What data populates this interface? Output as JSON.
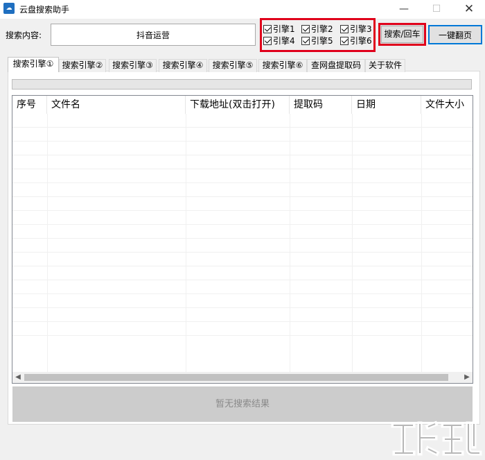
{
  "window": {
    "title": "云盘搜索助手",
    "icon": "cloud-app-icon",
    "controls": {
      "minimize": "—",
      "maximize": "☐",
      "close": "✕"
    }
  },
  "search": {
    "label": "搜索内容:",
    "value": "抖音运营"
  },
  "engines": [
    {
      "label": "引擎1",
      "checked": true
    },
    {
      "label": "引擎2",
      "checked": true
    },
    {
      "label": "引擎3",
      "checked": true
    },
    {
      "label": "引擎4",
      "checked": true
    },
    {
      "label": "引擎5",
      "checked": true
    },
    {
      "label": "引擎6",
      "checked": true
    }
  ],
  "buttons": {
    "search": "搜索/回车",
    "next_page": "一键翻页"
  },
  "tabs": [
    {
      "label": "搜索引擎①",
      "active": true
    },
    {
      "label": "搜索引擎②",
      "active": false
    },
    {
      "label": "搜索引擎③",
      "active": false
    },
    {
      "label": "搜索引擎④",
      "active": false
    },
    {
      "label": "搜索引擎⑤",
      "active": false
    },
    {
      "label": "搜索引擎⑥",
      "active": false
    },
    {
      "label": "查网盘提取码",
      "active": false
    },
    {
      "label": "关于软件",
      "active": false
    }
  ],
  "progress": {
    "value": 0
  },
  "table": {
    "columns": [
      "序号",
      "文件名",
      "下载地址(双击打开)",
      "提取码",
      "日期",
      "文件大小"
    ],
    "rows": []
  },
  "result_text": "暂无搜索结果",
  "colors": {
    "highlight_red": "#e0001b",
    "focus_blue": "#0078d7",
    "result_bar": "#cccccc"
  }
}
